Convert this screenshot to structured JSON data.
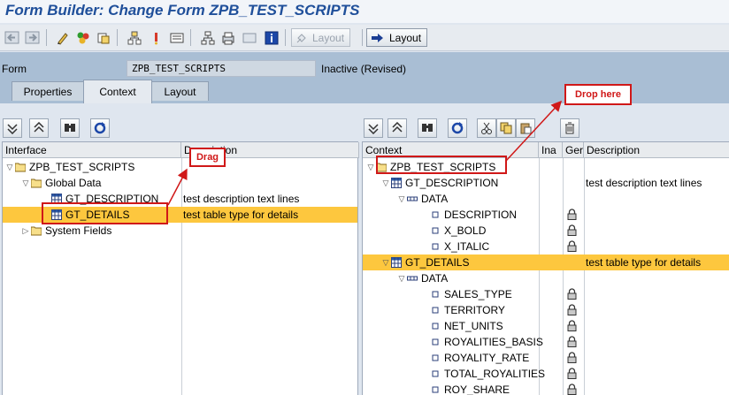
{
  "window": {
    "title": "Form Builder: Change Form ZPB_TEST_SCRIPTS"
  },
  "toolbar": {
    "layout_disabled_label": "Layout",
    "layout_label": "Layout",
    "icons": [
      "back-icon",
      "forward-icon",
      "edit-pen-icon",
      "activate-icon",
      "other-object-icon",
      "hierarchy-icon",
      "display-icon",
      "check-icon",
      "structure-icon",
      "print-preview-icon",
      "form-icon",
      "info-icon"
    ]
  },
  "header": {
    "form_label": "Form",
    "form_name": "ZPB_TEST_SCRIPTS",
    "status": "Inactive (Revised)",
    "tabs": [
      {
        "label": "Properties"
      },
      {
        "label": "Context",
        "active": true
      },
      {
        "label": "Layout"
      }
    ]
  },
  "left_panel": {
    "columns": [
      "Interface",
      "Description"
    ],
    "rows": [
      {
        "label": "ZPB_TEST_SCRIPTS",
        "description": "",
        "icon": "folder-icon"
      },
      {
        "label": "Global Data",
        "description": "",
        "icon": "folder-icon"
      },
      {
        "label": "GT_DESCRIPTION",
        "description": "test description text lines",
        "icon": "table-icon"
      },
      {
        "label": "GT_DETAILS",
        "description": "test table type for details",
        "icon": "table-icon",
        "selected": true
      },
      {
        "label": "System Fields",
        "description": "",
        "icon": "folder-icon"
      }
    ]
  },
  "right_panel": {
    "columns": [
      "Context",
      "Ina",
      "Ger",
      "Description"
    ],
    "rows": [
      {
        "label": "ZPB_TEST_SCRIPTS",
        "description": "",
        "icon": "folder-icon"
      },
      {
        "label": "GT_DESCRIPTION",
        "description": "test description text lines",
        "icon": "table-icon"
      },
      {
        "label": "DATA",
        "description": "",
        "icon": "structure-icon"
      },
      {
        "label": "DESCRIPTION",
        "description": "",
        "icon": "field-icon",
        "locked": true
      },
      {
        "label": "X_BOLD",
        "description": "",
        "icon": "field-icon",
        "locked": true
      },
      {
        "label": "X_ITALIC",
        "description": "",
        "icon": "field-icon",
        "locked": true
      },
      {
        "label": "GT_DETAILS",
        "description": "test table type for details",
        "icon": "table-icon",
        "selected": true
      },
      {
        "label": "DATA",
        "description": "",
        "icon": "structure-icon"
      },
      {
        "label": "SALES_TYPE",
        "description": "",
        "icon": "field-icon",
        "locked": true
      },
      {
        "label": "TERRITORY",
        "description": "",
        "icon": "field-icon",
        "locked": true
      },
      {
        "label": "NET_UNITS",
        "description": "",
        "icon": "field-icon",
        "locked": true
      },
      {
        "label": "ROYALITIES_BASIS",
        "description": "",
        "icon": "field-icon",
        "locked": true
      },
      {
        "label": "ROYALITY_RATE",
        "description": "",
        "icon": "field-icon",
        "locked": true
      },
      {
        "label": "TOTAL_ROYALITIES",
        "description": "",
        "icon": "field-icon",
        "locked": true
      },
      {
        "label": "ROY_SHARE",
        "description": "",
        "icon": "field-icon",
        "locked": true
      }
    ]
  },
  "annotations": {
    "drag_label": "Drag",
    "drop_label": "Drop here"
  },
  "colors": {
    "selection": "#fdc73e",
    "title": "#1f4f9a",
    "annotation": "#d01818"
  }
}
